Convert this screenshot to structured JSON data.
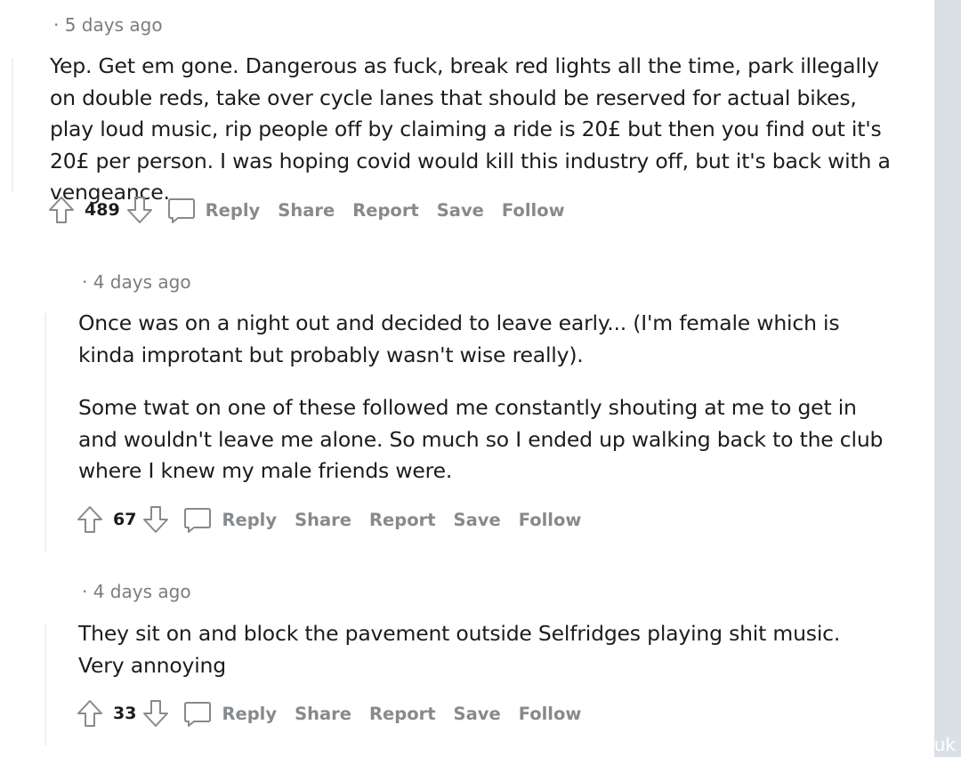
{
  "comments": [
    {
      "timestamp": "· 5 days ago",
      "paragraphs": [
        "Yep. Get em gone. Dangerous as fuck, break red lights all the time, park illegally on double reds, take over cycle lanes that should be reserved for actual bikes, play loud music, rip people off by claiming a ride is 20£ but then you find out it's 20£ per person. I was hoping covid would kill this industry off, but it's back with a vengeance."
      ],
      "score": "489"
    },
    {
      "timestamp": "· 4 days ago",
      "paragraphs": [
        "Once was on a night out and decided to leave early... (I'm female which is kinda improtant but probably wasn't wise really).",
        "Some twat on one of these followed me constantly shouting at me to get in and wouldn't leave me alone. So much so I ended up walking back to the club where I knew my male friends were."
      ],
      "score": "67"
    },
    {
      "timestamp": "· 4 days ago",
      "paragraphs": [
        "They sit on and block the pavement outside Selfridges playing shit music. Very annoying"
      ],
      "score": "33"
    }
  ],
  "actions": {
    "reply": "Reply",
    "share": "Share",
    "report": "Report",
    "save": "Save",
    "follow": "Follow"
  },
  "icons": {
    "upvote": "arrow-up-icon",
    "downvote": "arrow-down-icon",
    "comment": "speech-bubble-icon"
  },
  "watermark": "uk",
  "colors": {
    "text": "#1c1c1c",
    "meta": "#7c7c7c",
    "action": "#878a8c",
    "thread_line": "#edeff1",
    "gutter": "#dae0e6"
  }
}
